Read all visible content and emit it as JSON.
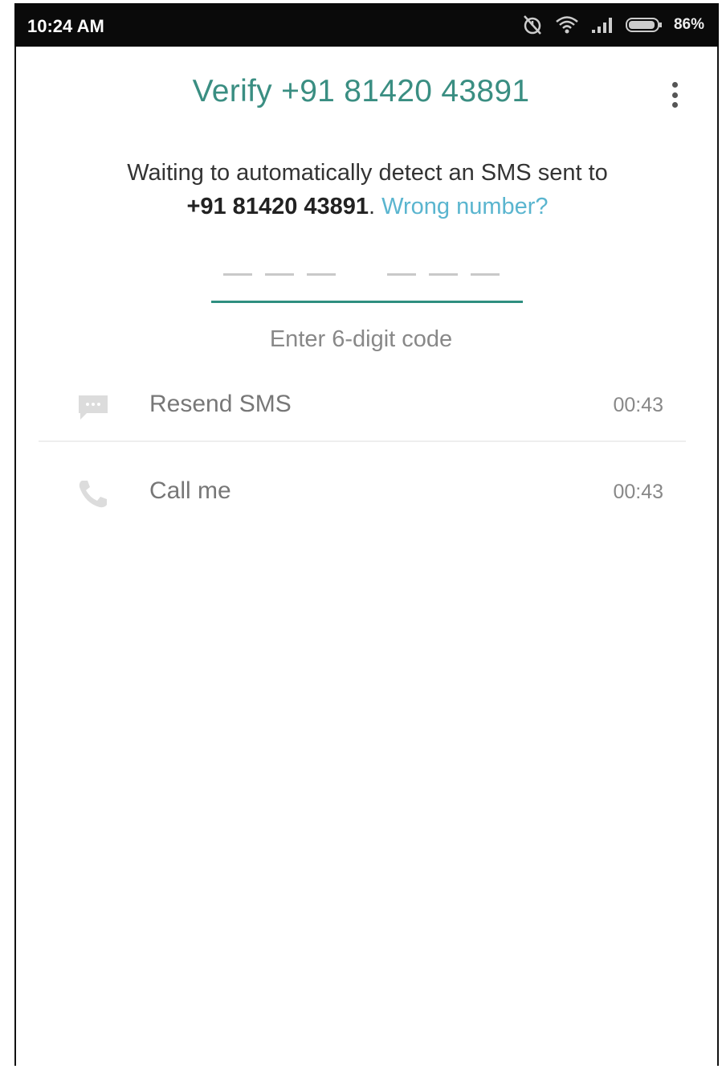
{
  "status_bar": {
    "time": "10:24 AM",
    "battery": "86%",
    "icons": [
      "alarm-off-icon",
      "wifi-icon",
      "signal-icon",
      "battery-icon"
    ]
  },
  "header": {
    "title": "Verify +91 81420 43891",
    "menu_icon": "more-vert-icon"
  },
  "message": {
    "prefix": "Waiting to automatically detect an SMS sent to",
    "number": "+91 81420 43891",
    "period": ".",
    "wrong_number_link": "Wrong number?"
  },
  "code_input": {
    "hint": "Enter 6-digit code",
    "digits": 6
  },
  "options": [
    {
      "icon": "message-icon",
      "label": "Resend SMS",
      "timer": "00:43"
    },
    {
      "icon": "phone-icon",
      "label": "Call me",
      "timer": "00:43"
    }
  ],
  "colors": {
    "accent": "#2f8f80",
    "title": "#3a8e82",
    "link": "#5ab5cf"
  }
}
